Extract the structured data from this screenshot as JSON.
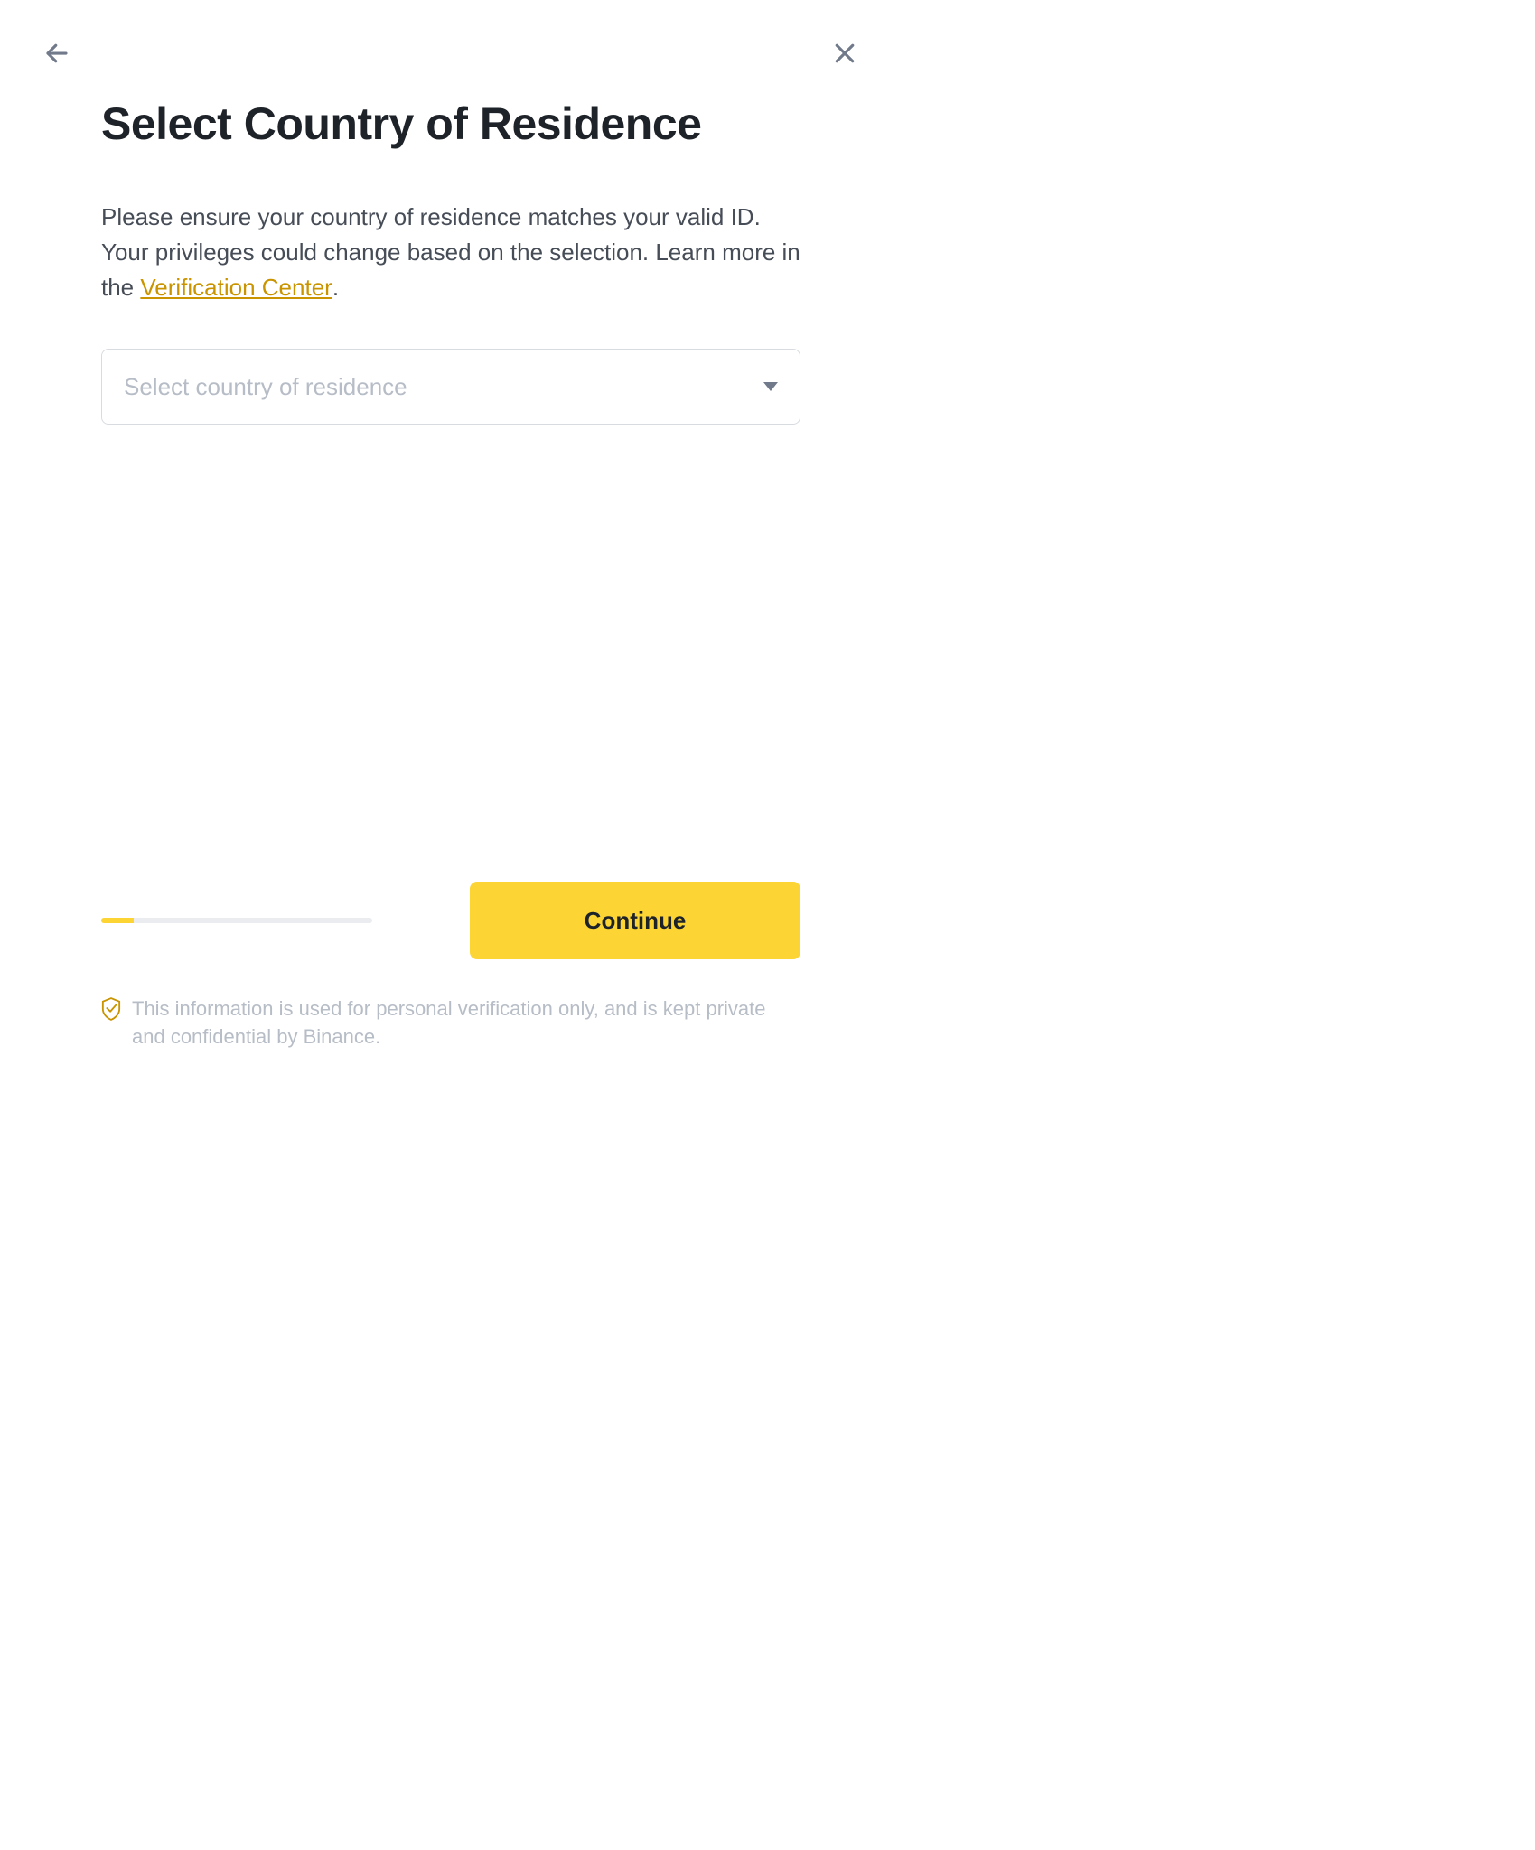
{
  "title": "Select Country of Residence",
  "desc_part1": "Please ensure your country of residence matches your valid ID. Your privileges could change based on the selection. Learn more in the ",
  "desc_link": "Verification Center",
  "desc_part2": ".",
  "select_placeholder": "Select country of residence",
  "continue_label": "Continue",
  "disclaimer": "This information is used for personal verification only, and is kept private and confidential by Binance."
}
